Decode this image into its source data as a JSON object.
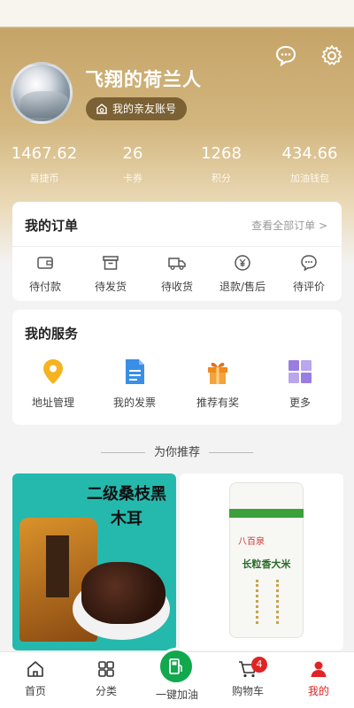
{
  "profile": {
    "username": "飞翔的荷兰人",
    "friend_account_label": "我的亲友账号"
  },
  "stats": [
    {
      "value": "1467.62",
      "label": "易捷币"
    },
    {
      "value": "26",
      "label": "卡券"
    },
    {
      "value": "1268",
      "label": "积分"
    },
    {
      "value": "434.66",
      "label": "加油钱包"
    }
  ],
  "orders": {
    "title": "我的订单",
    "see_all": "查看全部订单 >",
    "items": [
      {
        "label": "待付款",
        "icon": "wallet-icon"
      },
      {
        "label": "待发货",
        "icon": "box-icon"
      },
      {
        "label": "待收货",
        "icon": "truck-icon"
      },
      {
        "label": "退款/售后",
        "icon": "yen-icon"
      },
      {
        "label": "待评价",
        "icon": "comment-icon"
      }
    ]
  },
  "services": {
    "title": "我的服务",
    "items": [
      {
        "label": "地址管理",
        "icon": "location-icon",
        "color": "#f5b31f"
      },
      {
        "label": "我的发票",
        "icon": "invoice-icon",
        "color": "#3a8ee6"
      },
      {
        "label": "推荐有奖",
        "icon": "gift-icon",
        "color": "#f08a1c"
      },
      {
        "label": "更多",
        "icon": "grid-icon",
        "color": "#9a7de0"
      }
    ]
  },
  "recommend": {
    "title": "为你推荐",
    "products": [
      {
        "banner": "二级桑枝黑木耳"
      },
      {
        "brand": "八百泉",
        "name": "长粒香大米"
      }
    ]
  },
  "tabbar": {
    "items": [
      {
        "label": "首页",
        "icon": "home-icon"
      },
      {
        "label": "分类",
        "icon": "category-icon"
      },
      {
        "label": "一键加油",
        "icon": "fuel-icon"
      },
      {
        "label": "购物车",
        "icon": "cart-icon",
        "badge": "4"
      },
      {
        "label": "我的",
        "icon": "user-icon"
      }
    ]
  },
  "colors": {
    "accent": "#e02424",
    "brand_gold": "#c6a468",
    "fuel_green": "#12a84d"
  }
}
